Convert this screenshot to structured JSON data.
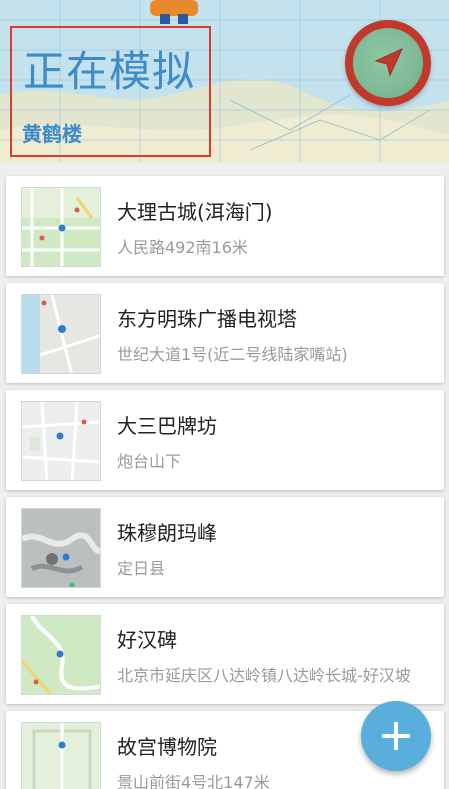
{
  "header": {
    "status_title": "正在模拟",
    "current_place": "黄鹤楼",
    "status_box_color": "#e03a2f",
    "accent": "#3d8cc8",
    "compass_icon": "navigation-arrow-icon"
  },
  "locations": [
    {
      "title": "大理古城(洱海门)",
      "subtitle": "人民路492南16米",
      "thumb": "map-thumbnail-green"
    },
    {
      "title": "东方明珠广播电视塔",
      "subtitle": "世纪大道1号(近二号线陆家嘴站)",
      "thumb": "map-thumbnail-gray"
    },
    {
      "title": "大三巴牌坊",
      "subtitle": "炮台山下",
      "thumb": "map-thumbnail-street"
    },
    {
      "title": "珠穆朗玛峰",
      "subtitle": "定日县",
      "thumb": "map-thumbnail-terrain"
    },
    {
      "title": "好汉碑",
      "subtitle": "北京市延庆区八达岭镇八达岭长城-好汉坡",
      "thumb": "map-thumbnail-green"
    },
    {
      "title": "故宫博物院",
      "subtitle": "景山前街4号北147米",
      "thumb": "map-thumbnail-palace"
    }
  ],
  "fab": {
    "icon": "plus-icon",
    "color": "#5aaedc"
  }
}
